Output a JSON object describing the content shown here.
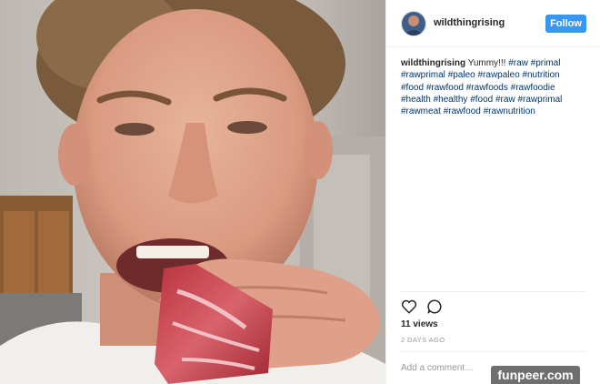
{
  "post": {
    "username": "wildthingrising",
    "follow_label": "Follow",
    "caption": {
      "username": "wildthingrising",
      "text": "Yummy!!!",
      "hashtags": [
        "#raw",
        "#primal",
        "#rawprimal",
        "#paleo",
        "#rawpaleo",
        "#nutrition",
        "#food",
        "#rawfood",
        "#rawfoods",
        "#rawfoodie",
        "#health",
        "#healthy",
        "#food",
        "#raw",
        "#rawprimal",
        "#rawmeat",
        "#rawfood",
        "#rawnutrition"
      ]
    },
    "actions": {
      "like_icon": "heart-icon",
      "comment_icon": "comment-icon"
    },
    "views": "11 views",
    "timestamp": "2 DAYS AGO",
    "comment_placeholder": "Add a comment…"
  },
  "watermark": "funpeer.com",
  "colors": {
    "follow_button": "#3897f0",
    "hashtag": "#003569",
    "muted": "#999999",
    "text": "#262626"
  }
}
